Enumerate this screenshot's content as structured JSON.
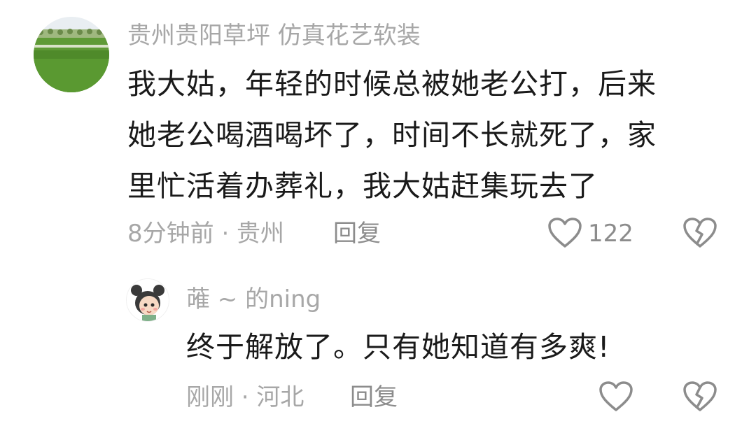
{
  "comments": [
    {
      "username": "贵州贵阳草坪  仿真花艺软装",
      "avatar_icon": "lawn-avatar",
      "text_lines": [
        "我大姑，年轻的时候总被她老公打，后来",
        "她老公喝酒喝坏了，时间不长就死了，家",
        "里忙活着办葬礼，我大姑赶集玩去了"
      ],
      "meta": "8分钟前 · 贵州",
      "reply_label": "回复",
      "like_count": "122",
      "like_icon": "heart-icon",
      "dislike_icon": "broken-heart-icon"
    },
    {
      "username": "蓶 ~ 的ning",
      "avatar_icon": "cartoon-girl-avatar",
      "text_lines": [
        "终于解放了。只有她知道有多爽!"
      ],
      "meta": "刚刚 · 河北",
      "reply_label": "回复",
      "like_icon": "heart-icon",
      "dislike_icon": "broken-heart-icon"
    }
  ],
  "colors": {
    "meta_gray": "#a7a7a7",
    "icon_gray": "#8c8c8c",
    "text_black": "#1a1a1a"
  }
}
